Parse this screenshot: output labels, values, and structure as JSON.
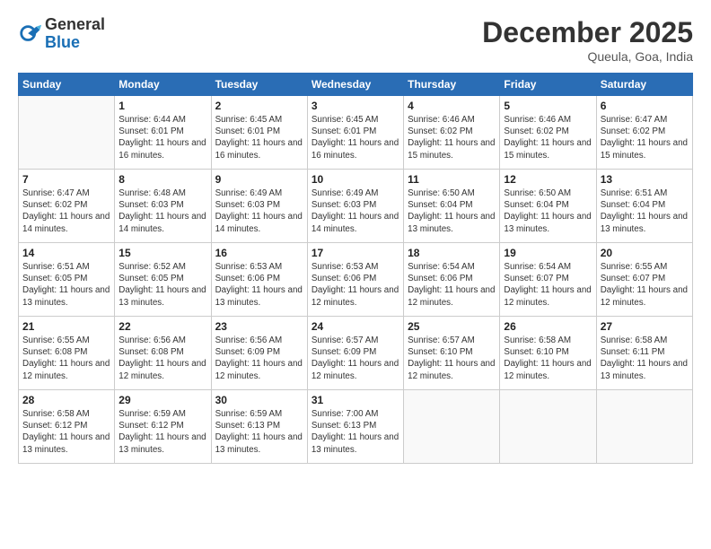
{
  "logo": {
    "general": "General",
    "blue": "Blue"
  },
  "title": "December 2025",
  "location": "Queula, Goa, India",
  "days_of_week": [
    "Sunday",
    "Monday",
    "Tuesday",
    "Wednesday",
    "Thursday",
    "Friday",
    "Saturday"
  ],
  "weeks": [
    [
      {
        "day": "",
        "sunrise": "",
        "sunset": "",
        "daylight": ""
      },
      {
        "day": "1",
        "sunrise": "Sunrise: 6:44 AM",
        "sunset": "Sunset: 6:01 PM",
        "daylight": "Daylight: 11 hours and 16 minutes."
      },
      {
        "day": "2",
        "sunrise": "Sunrise: 6:45 AM",
        "sunset": "Sunset: 6:01 PM",
        "daylight": "Daylight: 11 hours and 16 minutes."
      },
      {
        "day": "3",
        "sunrise": "Sunrise: 6:45 AM",
        "sunset": "Sunset: 6:01 PM",
        "daylight": "Daylight: 11 hours and 16 minutes."
      },
      {
        "day": "4",
        "sunrise": "Sunrise: 6:46 AM",
        "sunset": "Sunset: 6:02 PM",
        "daylight": "Daylight: 11 hours and 15 minutes."
      },
      {
        "day": "5",
        "sunrise": "Sunrise: 6:46 AM",
        "sunset": "Sunset: 6:02 PM",
        "daylight": "Daylight: 11 hours and 15 minutes."
      },
      {
        "day": "6",
        "sunrise": "Sunrise: 6:47 AM",
        "sunset": "Sunset: 6:02 PM",
        "daylight": "Daylight: 11 hours and 15 minutes."
      }
    ],
    [
      {
        "day": "7",
        "sunrise": "Sunrise: 6:47 AM",
        "sunset": "Sunset: 6:02 PM",
        "daylight": "Daylight: 11 hours and 14 minutes."
      },
      {
        "day": "8",
        "sunrise": "Sunrise: 6:48 AM",
        "sunset": "Sunset: 6:03 PM",
        "daylight": "Daylight: 11 hours and 14 minutes."
      },
      {
        "day": "9",
        "sunrise": "Sunrise: 6:49 AM",
        "sunset": "Sunset: 6:03 PM",
        "daylight": "Daylight: 11 hours and 14 minutes."
      },
      {
        "day": "10",
        "sunrise": "Sunrise: 6:49 AM",
        "sunset": "Sunset: 6:03 PM",
        "daylight": "Daylight: 11 hours and 14 minutes."
      },
      {
        "day": "11",
        "sunrise": "Sunrise: 6:50 AM",
        "sunset": "Sunset: 6:04 PM",
        "daylight": "Daylight: 11 hours and 13 minutes."
      },
      {
        "day": "12",
        "sunrise": "Sunrise: 6:50 AM",
        "sunset": "Sunset: 6:04 PM",
        "daylight": "Daylight: 11 hours and 13 minutes."
      },
      {
        "day": "13",
        "sunrise": "Sunrise: 6:51 AM",
        "sunset": "Sunset: 6:04 PM",
        "daylight": "Daylight: 11 hours and 13 minutes."
      }
    ],
    [
      {
        "day": "14",
        "sunrise": "Sunrise: 6:51 AM",
        "sunset": "Sunset: 6:05 PM",
        "daylight": "Daylight: 11 hours and 13 minutes."
      },
      {
        "day": "15",
        "sunrise": "Sunrise: 6:52 AM",
        "sunset": "Sunset: 6:05 PM",
        "daylight": "Daylight: 11 hours and 13 minutes."
      },
      {
        "day": "16",
        "sunrise": "Sunrise: 6:53 AM",
        "sunset": "Sunset: 6:06 PM",
        "daylight": "Daylight: 11 hours and 13 minutes."
      },
      {
        "day": "17",
        "sunrise": "Sunrise: 6:53 AM",
        "sunset": "Sunset: 6:06 PM",
        "daylight": "Daylight: 11 hours and 12 minutes."
      },
      {
        "day": "18",
        "sunrise": "Sunrise: 6:54 AM",
        "sunset": "Sunset: 6:06 PM",
        "daylight": "Daylight: 11 hours and 12 minutes."
      },
      {
        "day": "19",
        "sunrise": "Sunrise: 6:54 AM",
        "sunset": "Sunset: 6:07 PM",
        "daylight": "Daylight: 11 hours and 12 minutes."
      },
      {
        "day": "20",
        "sunrise": "Sunrise: 6:55 AM",
        "sunset": "Sunset: 6:07 PM",
        "daylight": "Daylight: 11 hours and 12 minutes."
      }
    ],
    [
      {
        "day": "21",
        "sunrise": "Sunrise: 6:55 AM",
        "sunset": "Sunset: 6:08 PM",
        "daylight": "Daylight: 11 hours and 12 minutes."
      },
      {
        "day": "22",
        "sunrise": "Sunrise: 6:56 AM",
        "sunset": "Sunset: 6:08 PM",
        "daylight": "Daylight: 11 hours and 12 minutes."
      },
      {
        "day": "23",
        "sunrise": "Sunrise: 6:56 AM",
        "sunset": "Sunset: 6:09 PM",
        "daylight": "Daylight: 11 hours and 12 minutes."
      },
      {
        "day": "24",
        "sunrise": "Sunrise: 6:57 AM",
        "sunset": "Sunset: 6:09 PM",
        "daylight": "Daylight: 11 hours and 12 minutes."
      },
      {
        "day": "25",
        "sunrise": "Sunrise: 6:57 AM",
        "sunset": "Sunset: 6:10 PM",
        "daylight": "Daylight: 11 hours and 12 minutes."
      },
      {
        "day": "26",
        "sunrise": "Sunrise: 6:58 AM",
        "sunset": "Sunset: 6:10 PM",
        "daylight": "Daylight: 11 hours and 12 minutes."
      },
      {
        "day": "27",
        "sunrise": "Sunrise: 6:58 AM",
        "sunset": "Sunset: 6:11 PM",
        "daylight": "Daylight: 11 hours and 13 minutes."
      }
    ],
    [
      {
        "day": "28",
        "sunrise": "Sunrise: 6:58 AM",
        "sunset": "Sunset: 6:12 PM",
        "daylight": "Daylight: 11 hours and 13 minutes."
      },
      {
        "day": "29",
        "sunrise": "Sunrise: 6:59 AM",
        "sunset": "Sunset: 6:12 PM",
        "daylight": "Daylight: 11 hours and 13 minutes."
      },
      {
        "day": "30",
        "sunrise": "Sunrise: 6:59 AM",
        "sunset": "Sunset: 6:13 PM",
        "daylight": "Daylight: 11 hours and 13 minutes."
      },
      {
        "day": "31",
        "sunrise": "Sunrise: 7:00 AM",
        "sunset": "Sunset: 6:13 PM",
        "daylight": "Daylight: 11 hours and 13 minutes."
      },
      {
        "day": "",
        "sunrise": "",
        "sunset": "",
        "daylight": ""
      },
      {
        "day": "",
        "sunrise": "",
        "sunset": "",
        "daylight": ""
      },
      {
        "day": "",
        "sunrise": "",
        "sunset": "",
        "daylight": ""
      }
    ]
  ]
}
